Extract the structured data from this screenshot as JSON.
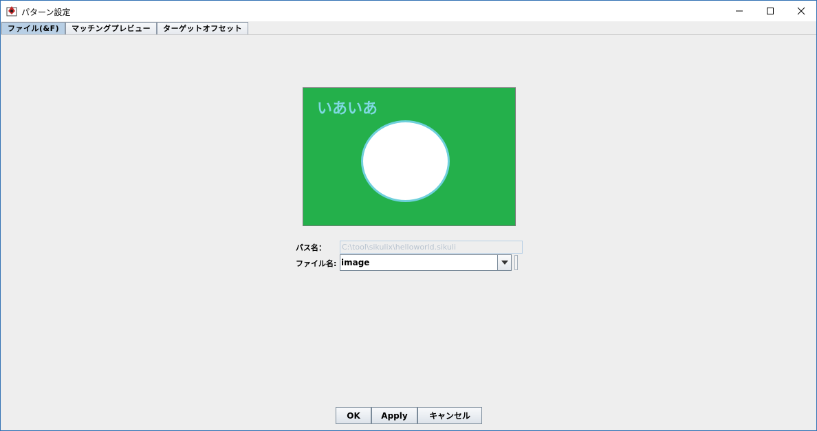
{
  "window": {
    "title": "パターン設定",
    "controls": {
      "minimize": "—",
      "maximize": "☐",
      "close": "✕"
    }
  },
  "tabs": [
    {
      "label": "ファイル(&F)",
      "selected": true
    },
    {
      "label": "マッチングプレビュー",
      "selected": false
    },
    {
      "label": "ターゲットオフセット",
      "selected": false
    }
  ],
  "preview": {
    "text": "いあいあ",
    "colors": {
      "background": "#24b04b",
      "text": "#7fd8e0",
      "circle_fill": "#ffffff",
      "circle_border": "#6fd0dc"
    }
  },
  "form": {
    "path_label": "パス名：",
    "path_value": "C:\\tool\\sikulix\\helloworld.sikuli",
    "file_label": "ファイル名:",
    "file_value": "image"
  },
  "buttons": {
    "ok": "OK",
    "apply": "Apply",
    "cancel": "キャンセル"
  },
  "icons": {
    "app": "sikulix-app-icon",
    "dropdown": "chevron-down-icon"
  }
}
